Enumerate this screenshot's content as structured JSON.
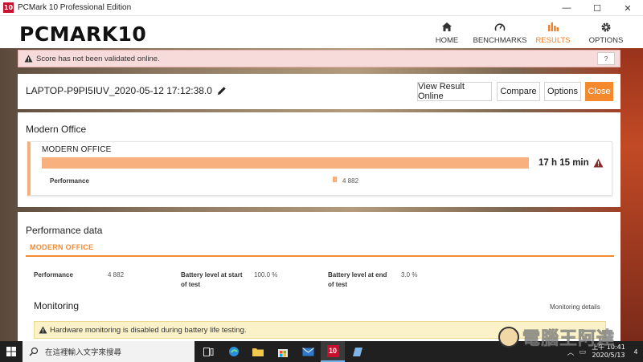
{
  "window": {
    "app_icon_text": "10",
    "title": "PCMark 10 Professional Edition",
    "controls": [
      "—",
      "☐",
      "✕"
    ]
  },
  "header": {
    "logo": "PCMARK10",
    "nav": [
      {
        "label": "HOME",
        "icon": "home-icon",
        "active": false
      },
      {
        "label": "BENCHMARKS",
        "icon": "gauge-icon",
        "active": false
      },
      {
        "label": "RESULTS",
        "icon": "bar-chart-icon",
        "active": true
      },
      {
        "label": "OPTIONS",
        "icon": "gear-icon",
        "active": false
      }
    ],
    "accent_color": "#f07f2e"
  },
  "banner": {
    "text": "Score has not been validated online.",
    "help_label": "?"
  },
  "result": {
    "name": "LAPTOP-P9PI5IUV_2020-05-12 17:12:38.0",
    "buttons": {
      "view_online": "View Result Online",
      "compare": "Compare",
      "options": "Options",
      "close": "Close"
    }
  },
  "modern_office": {
    "section_title": "Modern Office",
    "card_title": "MODERN OFFICE",
    "duration": "17 h 15 min",
    "performance_label": "Performance",
    "performance_value": "4 882",
    "performance_marker_fraction": 0.597
  },
  "performance_data": {
    "title": "Performance data",
    "tab": "MODERN OFFICE",
    "items": [
      {
        "label": "Performance",
        "value": "4 882"
      },
      {
        "label": "Battery level at start of test",
        "value": "100.0 %"
      },
      {
        "label": "Battery level at end of test",
        "value": "3.0 %"
      }
    ],
    "monitoring_title": "Monitoring",
    "monitoring_details": "Monitoring details",
    "monitoring_warning": "Hardware monitoring is disabled during battery life testing."
  },
  "taskbar": {
    "search_placeholder": "在這裡輸入文字來搜尋",
    "apps": [
      "task-view-icon",
      "edge-icon",
      "file-explorer-icon",
      "store-icon",
      "mail-icon",
      "pcmark-icon",
      "notes-icon"
    ],
    "pcmark_icon_text": "10",
    "time": "上午 10:41",
    "date": "2020/5/13",
    "notifications": "4"
  }
}
